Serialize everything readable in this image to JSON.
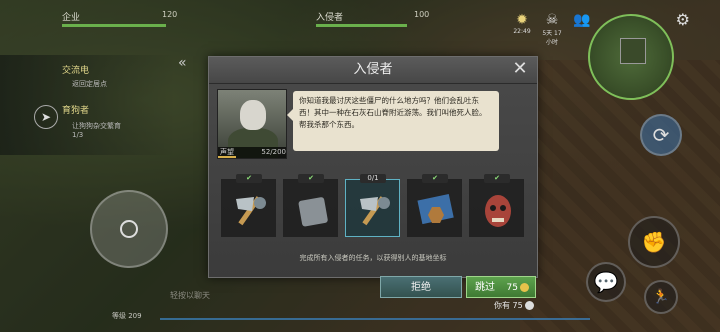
{
  "hud": {
    "stat_left_label": "企业",
    "stat_left_value": "120",
    "stat_left_fill": 0.8,
    "stat_right_label": "入侵者",
    "stat_right_value": "100",
    "stat_right_fill": 0.7,
    "time": "22:49",
    "days": "5天 17小时"
  },
  "left_panel": {
    "quest1_title": "交流电",
    "quest1_sub": "返回定居点",
    "quest2_title": "育狗者",
    "quest2_sub": "让狗狗杂交繁育",
    "quest2_progress": "1/3"
  },
  "modal": {
    "title": "入侵者",
    "story": "你知道我最讨厌这些僵尸的什么地方吗？他们会乱吐东西！其中一种在石灰石山脊附近游荡。我们叫他死人脸。帮我杀那个东西。",
    "reputation_label": "声望",
    "reputation_value": "52/200",
    "reputation_fill": 0.26,
    "active_task_progress": "0/1",
    "hint": "完成所有入侵者的任务，以获得别人的基地坐标",
    "refuse_label": "拒绝",
    "skip_label": "跳过",
    "skip_cost": "75",
    "have_label": "你有 75"
  },
  "bottom": {
    "chat_placeholder": "轻按以聊天",
    "level": "等级 209"
  },
  "colors": {
    "accent_green": "#6ab04c",
    "active_task": "#5fb2c4",
    "coin": "#e6c24b"
  }
}
